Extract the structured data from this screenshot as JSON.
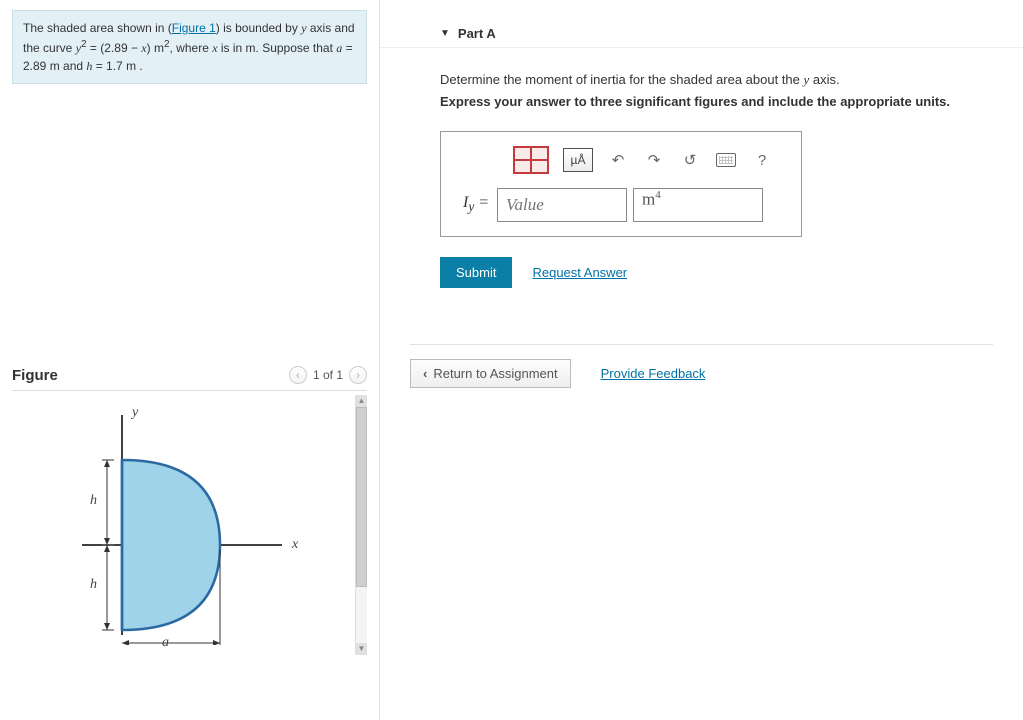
{
  "problem": {
    "text_pre": "The shaded area shown in (",
    "figure_link": "Figure 1",
    "text_mid": ") is bounded by ",
    "axis1": "y",
    "axis1_after": " axis and the curve ",
    "eq_lhs": "y",
    "eq_lhs_sup": "2",
    "eq_mid": " = (2.89 − ",
    "eq_x": "x",
    "eq_rhs": ") m",
    "eq_rhs_sup": "2",
    "eq_tail": ", where ",
    "eq_xvar": "x",
    "eq_tail2": " is in m. Suppose that ",
    "a_var": "a",
    "a_eq": " = 2.89  m and ",
    "h_var": "h",
    "h_eq": " = 1.7  m ."
  },
  "figure": {
    "title": "Figure",
    "counter": "1 of 1",
    "labels": {
      "y": "y",
      "x": "x",
      "h": "h",
      "a": "a"
    }
  },
  "part": {
    "label": "Part A",
    "instruction": "Determine the moment of inertia for the shaded area about the y axis.",
    "instruction_var": "y",
    "instruction_suffix": " axis.",
    "instruction_pre": "Determine the moment of inertia for the shaded area about the ",
    "express": "Express your answer to three significant figures and include the appropriate units."
  },
  "toolbar": {
    "units_label": "µÅ",
    "help_label": "?"
  },
  "answer": {
    "symbol": "I",
    "subscript": "y",
    "equals": " = ",
    "value_placeholder": "Value",
    "unit_base": "m",
    "unit_exp": "4"
  },
  "actions": {
    "submit": "Submit",
    "request": "Request Answer",
    "return": "Return to Assignment",
    "feedback": "Provide Feedback"
  }
}
